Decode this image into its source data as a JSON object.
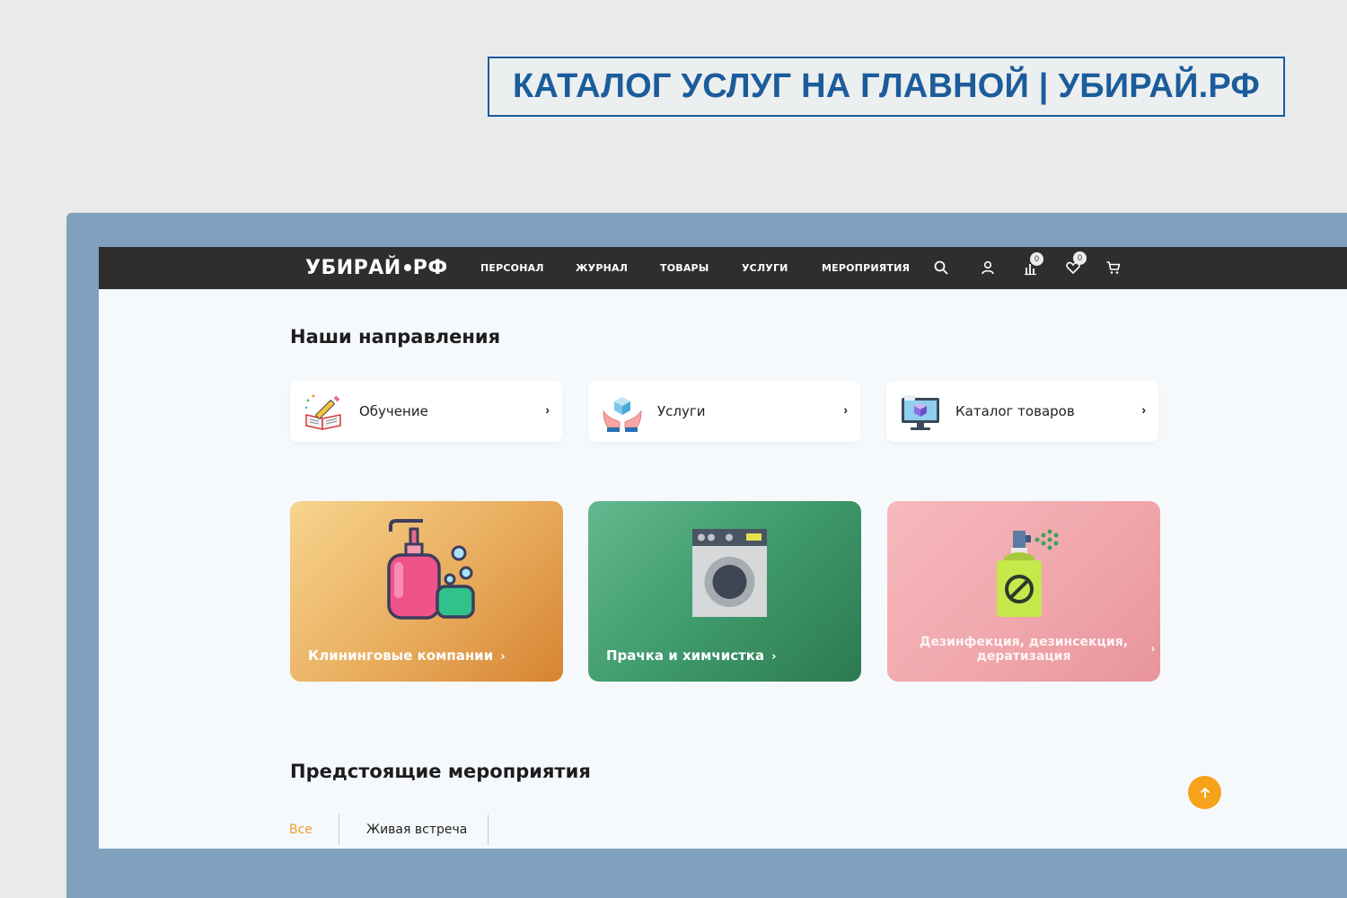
{
  "banner": {
    "title": "КАТАЛОГ УСЛУГ НА ГЛАВНОЙ | УБИРАЙ.РФ"
  },
  "header": {
    "logo_left": "УБИРАЙ",
    "logo_right": "РФ",
    "nav": [
      "ПЕРСОНАЛ",
      "ЖУРНАЛ",
      "ТОВАРЫ",
      "УСЛУГИ",
      "МЕРОПРИЯТИЯ"
    ],
    "compare_count": "0",
    "favorites_count": "0",
    "icons": [
      "search-icon",
      "user-icon",
      "compare-icon",
      "heart-icon",
      "cart-icon"
    ]
  },
  "directions": {
    "title": "Наши направления",
    "items": [
      {
        "label": "Обучение",
        "icon": "book-pencil-icon"
      },
      {
        "label": "Услуги",
        "icon": "hands-cube-icon"
      },
      {
        "label": "Каталог товаров",
        "icon": "monitor-cube-icon"
      }
    ]
  },
  "services": [
    {
      "label": "Клининговые компании",
      "icon": "soap-dispenser-icon"
    },
    {
      "label": "Прачка и химчистка",
      "icon": "washing-machine-icon"
    },
    {
      "label": "Дезинфекция, дезинсекция, дератизация",
      "icon": "spray-bottle-icon"
    }
  ],
  "events": {
    "title": "Предстоящие мероприятия",
    "tabs": [
      {
        "label": "Все",
        "active": true
      },
      {
        "label": "Живая встреча",
        "active": false
      }
    ]
  },
  "colors": {
    "banner": "#1b5c9c",
    "frame": "#7fa1be",
    "navbar": "#2e2e2e",
    "accent": "#f7a21b"
  }
}
